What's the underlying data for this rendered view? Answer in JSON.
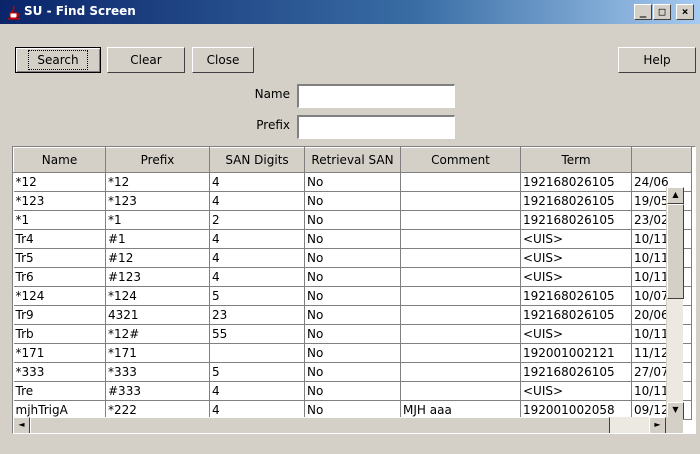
{
  "window": {
    "title": "SU - Find Screen",
    "minimize": "_",
    "maximize": "□",
    "close": "×"
  },
  "toolbar": {
    "search_label": "Search",
    "clear_label": "Clear",
    "close_label": "Close",
    "help_label": "Help"
  },
  "form": {
    "name_label": "Name",
    "name_value": "",
    "prefix_label": "Prefix",
    "prefix_value": ""
  },
  "table": {
    "columns": [
      "Name",
      "Prefix",
      "SAN Digits",
      "Retrieval SAN",
      "Comment",
      "Term",
      ""
    ],
    "rows": [
      [
        "*12",
        "*12",
        "4",
        "No",
        "",
        "192168026105",
        "24/06"
      ],
      [
        "*123",
        "*123",
        "4",
        "No",
        "",
        "192168026105",
        "19/05"
      ],
      [
        "*1",
        "*1",
        "2",
        "No",
        "",
        "192168026105",
        "23/02"
      ],
      [
        "Tr4",
        "#1",
        "4",
        "No",
        "",
        "<UIS>",
        "10/11"
      ],
      [
        "Tr5",
        "#12",
        "4",
        "No",
        "",
        "<UIS>",
        "10/11"
      ],
      [
        "Tr6",
        "#123",
        "4",
        "No",
        "",
        "<UIS>",
        "10/11"
      ],
      [
        "*124",
        "*124",
        "5",
        "No",
        "",
        "192168026105",
        "10/07"
      ],
      [
        "Tr9",
        "4321",
        "23",
        "No",
        "",
        "192168026105",
        "20/06"
      ],
      [
        "Trb",
        "*12#",
        "55",
        "No",
        "",
        "<UIS>",
        "10/11"
      ],
      [
        "*171",
        "*171",
        "",
        "No",
        "",
        "192001002121",
        "11/12"
      ],
      [
        "*333",
        "*333",
        "5",
        "No",
        "",
        "192168026105",
        "27/07"
      ],
      [
        "Tre",
        "#333",
        "4",
        "No",
        "",
        "<UIS>",
        "10/11"
      ],
      [
        "mjhTrigA",
        "*222",
        "4",
        "No",
        "MJH aaa",
        "192001002058",
        "09/12"
      ]
    ]
  },
  "scrollbars": {
    "up_arrow": "▲",
    "down_arrow": "▼",
    "left_arrow": "◄",
    "right_arrow": "►"
  }
}
